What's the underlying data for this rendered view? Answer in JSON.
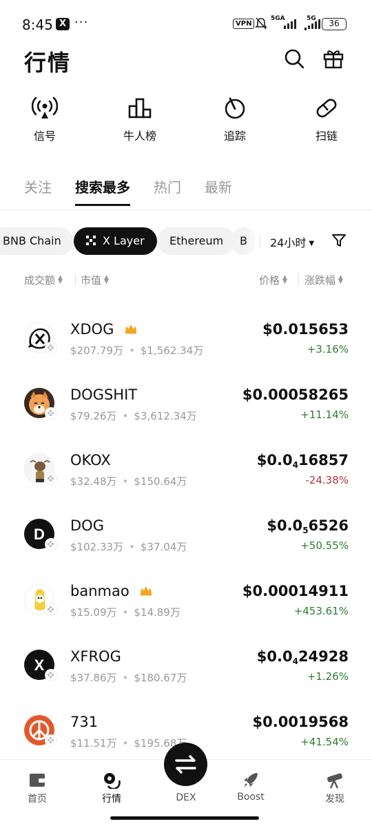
{
  "status_bar": {
    "time": "8:45",
    "app_badge": "X",
    "more": "···",
    "vpn": "VPN",
    "signal1": "5GA",
    "signal2": "5G",
    "battery": "36"
  },
  "header": {
    "title": "行情",
    "search_icon": "search-icon",
    "gift_icon": "gift-icon"
  },
  "quick_actions": [
    {
      "label": "信号",
      "icon": "signal-broadcast-icon"
    },
    {
      "label": "牛人榜",
      "icon": "leaderboard-icon"
    },
    {
      "label": "追踪",
      "icon": "tracking-icon"
    },
    {
      "label": "扫链",
      "icon": "chain-link-icon"
    }
  ],
  "tabs": [
    {
      "label": "关注",
      "active": false
    },
    {
      "label": "搜索最多",
      "active": true
    },
    {
      "label": "热门",
      "active": false
    },
    {
      "label": "最新",
      "active": false
    }
  ],
  "chains": [
    {
      "label": "BNB Chain",
      "active": false
    },
    {
      "label": "X Layer",
      "active": true
    },
    {
      "label": "Ethereum",
      "active": false
    },
    {
      "label": "B",
      "active": false
    }
  ],
  "period": "24小时",
  "sort_headers": {
    "volume": "成交额",
    "market_cap": "市值",
    "price": "价格",
    "change": "涨跌幅"
  },
  "tokens": [
    {
      "name": "XDOG",
      "crown": true,
      "volume": "$207.79万",
      "mcap": "$1,562.34万",
      "price": "$0.015653",
      "change": "+3.16%",
      "direction": "up"
    },
    {
      "name": "DOGSHIT",
      "crown": false,
      "volume": "$79.26万",
      "mcap": "$3,612.34万",
      "price": "$0.00058265",
      "change": "+11.14%",
      "direction": "up"
    },
    {
      "name": "OKOX",
      "crown": false,
      "volume": "$32.48万",
      "mcap": "$150.64万",
      "price_prefix": "$0.0",
      "price_sub": "4",
      "price_digits": "16857",
      "change": "-24.38%",
      "direction": "down"
    },
    {
      "name": "DOG",
      "crown": false,
      "volume": "$102.33万",
      "mcap": "$37.04万",
      "price_prefix": "$0.0",
      "price_sub": "5",
      "price_digits": "6526",
      "change": "+50.55%",
      "direction": "up"
    },
    {
      "name": "banmao",
      "crown": true,
      "volume": "$15.09万",
      "mcap": "$14.89万",
      "price": "$0.00014911",
      "change": "+453.61%",
      "direction": "up"
    },
    {
      "name": "XFROG",
      "crown": false,
      "volume": "$37.86万",
      "mcap": "$180.67万",
      "price_prefix": "$0.0",
      "price_sub": "4",
      "price_digits": "24928",
      "change": "+1.26%",
      "direction": "up"
    },
    {
      "name": "731",
      "crown": false,
      "volume": "$11.51万",
      "mcap": "$195.68万",
      "price": "$0.0019568",
      "change": "+41.54%",
      "direction": "up"
    }
  ],
  "bottom_nav": [
    {
      "label": "首页",
      "icon": "wallet-icon"
    },
    {
      "label": "行情",
      "icon": "market-icon",
      "active": true
    },
    {
      "label": "DEX",
      "icon": "swap-icon"
    },
    {
      "label": "Boost",
      "icon": "rocket-icon"
    },
    {
      "label": "发现",
      "icon": "telescope-icon"
    }
  ],
  "colors": {
    "up": "#2e7d32",
    "down": "#b0324a",
    "crown": "#f5a623"
  }
}
